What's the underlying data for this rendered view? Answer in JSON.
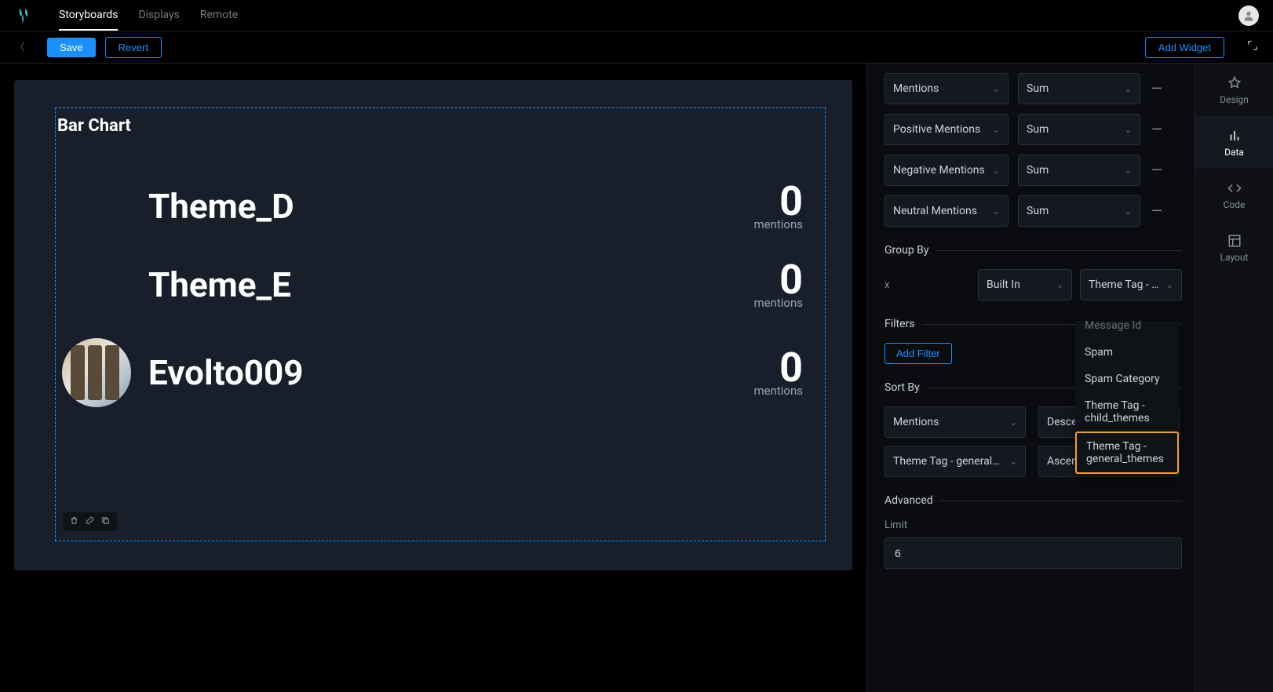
{
  "nav": {
    "tabs": [
      "Storyboards",
      "Displays",
      "Remote"
    ],
    "active": 0
  },
  "toolbar": {
    "save": "Save",
    "revert": "Revert",
    "addWidget": "Add Widget"
  },
  "widget": {
    "title": "Bar Chart",
    "unit": "mentions",
    "rows": [
      {
        "label": "Theme_D",
        "value": "0",
        "hasAvatar": false
      },
      {
        "label": "Theme_E",
        "value": "0",
        "hasAvatar": false
      },
      {
        "label": "Evolto009",
        "value": "0",
        "hasAvatar": true
      }
    ]
  },
  "rail": {
    "items": [
      "Design",
      "Data",
      "Code",
      "Layout"
    ],
    "active": 1
  },
  "config": {
    "metrics": [
      {
        "name": "Mentions",
        "agg": "Sum"
      },
      {
        "name": "Positive Mentions",
        "agg": "Sum"
      },
      {
        "name": "Negative Mentions",
        "agg": "Sum"
      },
      {
        "name": "Neutral Mentions",
        "agg": "Sum"
      }
    ],
    "groupByLabel": "Group By",
    "groupBy": {
      "x": "x",
      "source": "Built In",
      "field": "Theme Tag - …"
    },
    "filtersLabel": "Filters",
    "addFilter": "Add Filter",
    "sortByLabel": "Sort By",
    "sorts": [
      {
        "field": "Mentions",
        "dir": "Desce"
      },
      {
        "field": "Theme Tag - general…",
        "dir": "Ascending"
      }
    ],
    "advancedLabel": "Advanced",
    "limitLabel": "Limit",
    "limitValue": "6",
    "dropdown": {
      "items": [
        {
          "label": "Message Id",
          "state": "truncated"
        },
        {
          "label": "Spam",
          "state": ""
        },
        {
          "label": "Spam Category",
          "state": ""
        },
        {
          "label": "Theme Tag - child_themes",
          "state": ""
        },
        {
          "label": "Theme Tag - general_themes",
          "state": "highlighted"
        }
      ]
    }
  },
  "chart_data": {
    "type": "bar",
    "orientation": "horizontal",
    "title": "Bar Chart",
    "categories": [
      "Theme_D",
      "Theme_E",
      "Evolto009"
    ],
    "values": [
      0,
      0,
      0
    ],
    "ylabel": "mentions"
  }
}
